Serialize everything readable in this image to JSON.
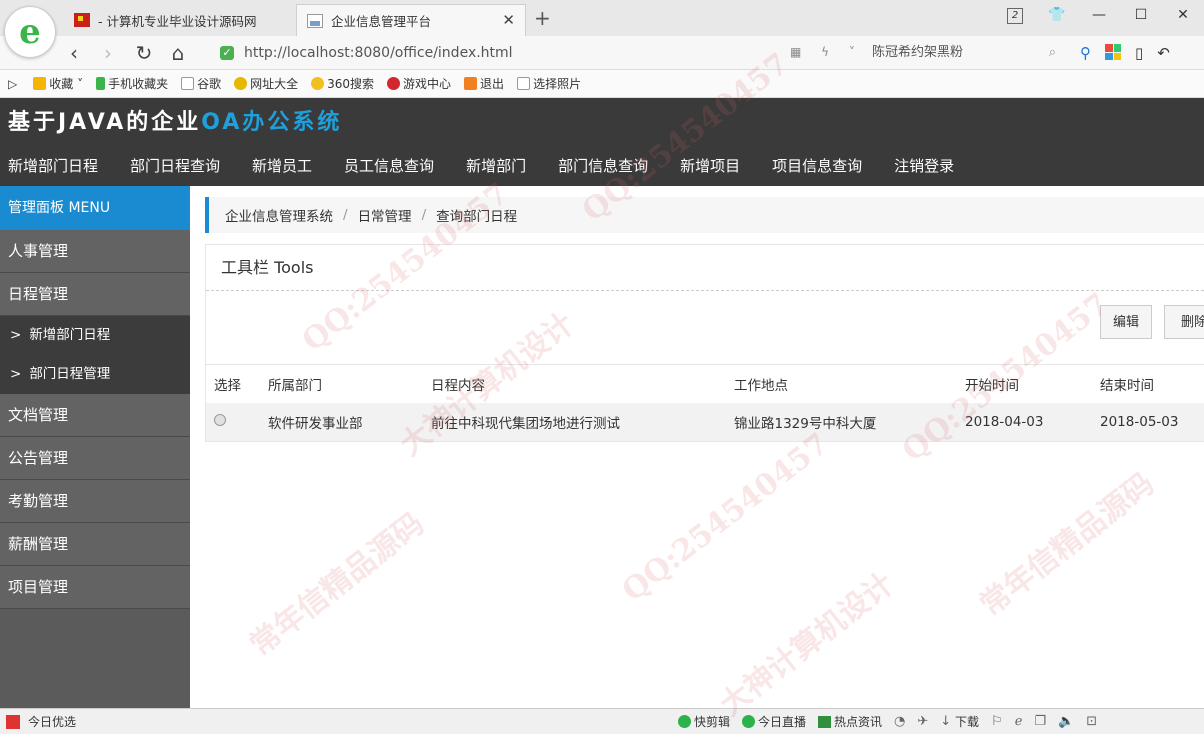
{
  "browser": {
    "tab_count": "2",
    "tabs": [
      {
        "title": "- 计算机专业毕业设计源码网",
        "active": false
      },
      {
        "title": "企业信息管理平台",
        "active": true
      }
    ],
    "url": "http://localhost:8080/office/index.html",
    "search_text": "陈冠希约架黑粉",
    "bookmarks": [
      "收藏",
      "手机收藏夹",
      "谷歌",
      "网址大全",
      "360搜索",
      "游戏中心",
      "退出",
      "选择照片"
    ]
  },
  "app": {
    "title_main": "基于JAVA的企业",
    "title_accent": "OA办公系统",
    "top_nav": [
      "新增部门日程",
      "部门日程查询",
      "新增员工",
      "员工信息查询",
      "新增部门",
      "部门信息查询",
      "新增项目",
      "项目信息查询",
      "注销登录"
    ]
  },
  "sidebar": {
    "header": "管理面板 MENU",
    "items": [
      {
        "label": "人事管理"
      },
      {
        "label": "日程管理"
      },
      {
        "label": "新增部门日程",
        "sub": true
      },
      {
        "label": "部门日程管理",
        "sub": true
      },
      {
        "label": "文档管理"
      },
      {
        "label": "公告管理"
      },
      {
        "label": "考勤管理"
      },
      {
        "label": "薪酬管理"
      },
      {
        "label": "项目管理"
      }
    ]
  },
  "breadcrumb": [
    "企业信息管理系统",
    "日常管理",
    "查询部门日程"
  ],
  "panel": {
    "title": "工具栏 Tools",
    "edit_label": "编辑",
    "delete_label": "删除"
  },
  "table": {
    "headers": [
      "选择",
      "所属部门",
      "日程内容",
      "工作地点",
      "开始时间",
      "结束时间"
    ],
    "rows": [
      {
        "department": "软件研发事业部",
        "content": "前往中科现代集团场地进行测试",
        "location": "锦业路1329号中科大厦",
        "start": "2018-04-03",
        "end": "2018-05-03"
      }
    ]
  },
  "statusbar": {
    "left": "今日优选",
    "items": [
      "快剪辑",
      "今日直播",
      "热点资讯",
      "下载"
    ]
  },
  "watermarks": [
    "QQ:254540457",
    "大神计算机设计",
    "常年信精品源码"
  ]
}
